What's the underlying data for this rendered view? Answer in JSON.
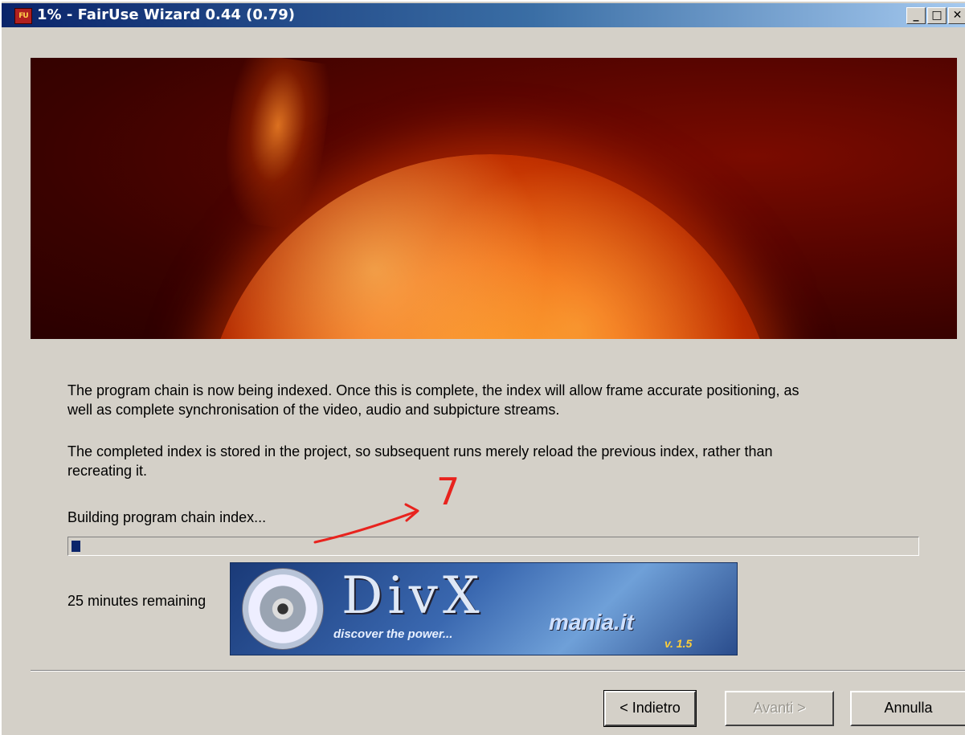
{
  "window": {
    "title": "1% - FairUse Wizard 0.44 (0.79)",
    "icon_label": "FU",
    "buttons": {
      "minimize": "_",
      "maximize": "□",
      "close": "✕"
    }
  },
  "content": {
    "paragraph1": "The program chain is now being indexed. Once this is complete, the index will allow frame accurate positioning, as\nwell as complete synchronisation of the video, audio and subpicture streams.",
    "paragraph2": "The completed index is stored in the project, so subsequent runs merely reload the previous index, rather than\nrecreating it.",
    "status_label": "Building program chain index...",
    "progress_fraction": 0.01,
    "time_remaining": "25 minutes remaining"
  },
  "banner": {
    "logo": "DivX",
    "tagline": "discover the power...",
    "site": "mania.it",
    "version": "v. 1.5"
  },
  "annotation": {
    "label": "7",
    "color": "#e8231e"
  },
  "footer": {
    "back_label": "< Indietro",
    "next_label": "Avanti >",
    "cancel_label": "Annulla"
  },
  "colors": {
    "titlebar_start": "#0a246a",
    "progress_fill": "#0a246a",
    "dialog_bg": "#d4d0c8"
  }
}
